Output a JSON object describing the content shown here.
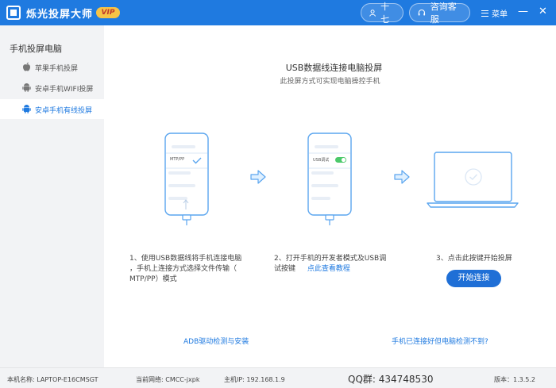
{
  "app": {
    "title": "烁光投屏大师",
    "vip_badge": "VIP"
  },
  "header": {
    "user_label": "十七",
    "service_label": "咨询客服",
    "menu_label": "菜单",
    "minimize": "—",
    "close": "✕"
  },
  "sidebar": {
    "heading": "手机投屏电脑",
    "items": [
      {
        "label": "苹果手机投屏",
        "icon": "apple-icon"
      },
      {
        "label": "安卓手机WIFI投屏",
        "icon": "android-icon"
      },
      {
        "label": "安卓手机有线投屏",
        "icon": "android-icon",
        "active": true
      }
    ]
  },
  "main": {
    "title": "USB数据线连接电脑投屏",
    "subtitle": "此投屏方式可实现电脑操控手机",
    "phone1_label": "MTP/PP",
    "phone2_label": "USB调试",
    "step1": [
      "1、使用USB数据线将手机连接电脑",
      "，手机上连接方式选择文件传输（",
      "MTP/PP）模式"
    ],
    "step2_line1": "2、打开手机的开发者模式及USB调",
    "step2_line2": "试按键",
    "step2_link": "点此查看教程",
    "step3": "3、点击此按键开始投屏",
    "connect_button": "开始连接",
    "adb_link": "ADB驱动检测与安装",
    "not_detected_link": "手机已连接好但电脑检测不到?"
  },
  "status": {
    "host_name": "本机名称: LAPTOP-E16CMSGT",
    "network": "当前网络: CMCC-jxpk",
    "host_ip": "主机IP: 192.168.1.9",
    "qq": "QQ群:  434748530",
    "version": "版本：1.3.5.2"
  },
  "colors": {
    "accent": "#1f7ae0",
    "button": "#1f6fd6",
    "vip": "#f6c346",
    "illustration": "#5aa5ef"
  }
}
